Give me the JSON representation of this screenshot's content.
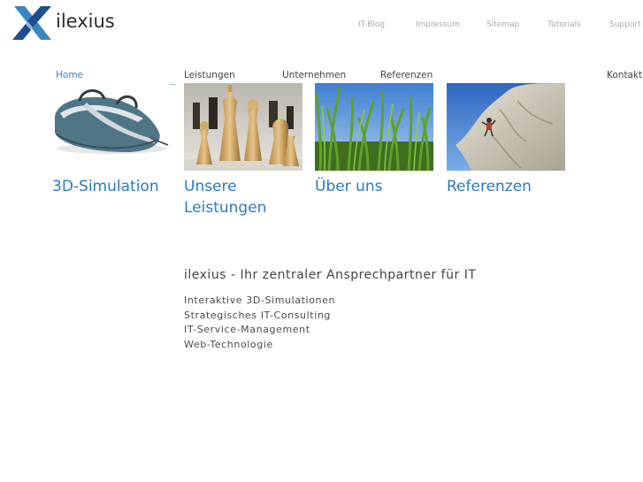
{
  "brand": {
    "name": "ilexius",
    "accent": "#3a86c2",
    "logo_colors": [
      "#1e4e8c",
      "#3a86c2",
      "#8fb8da"
    ]
  },
  "util_nav": [
    "IT-Blog",
    "Impressum",
    "Sitemap",
    "Tutorials",
    "Support"
  ],
  "main_nav": {
    "active": "Home",
    "items": [
      "Home",
      "Leistungen",
      "Unternehmen",
      "Referenzen",
      "Kontakt"
    ]
  },
  "teasers": [
    {
      "title": "3D-Simulation",
      "image": "3d-bag-model-image"
    },
    {
      "title": "Unsere Leistungen",
      "image": "chess-pieces-image"
    },
    {
      "title": "Über uns",
      "image": "grass-blades-image"
    },
    {
      "title": "Referenzen",
      "image": "rock-climber-image"
    }
  ],
  "content": {
    "headline": "ilexius - Ihr zentraler Ansprechpartner für IT",
    "services": [
      "Interaktive 3D-Simulationen",
      "Strategisches IT-Consulting",
      "IT-Service-Management",
      "Web-Technologie"
    ]
  }
}
